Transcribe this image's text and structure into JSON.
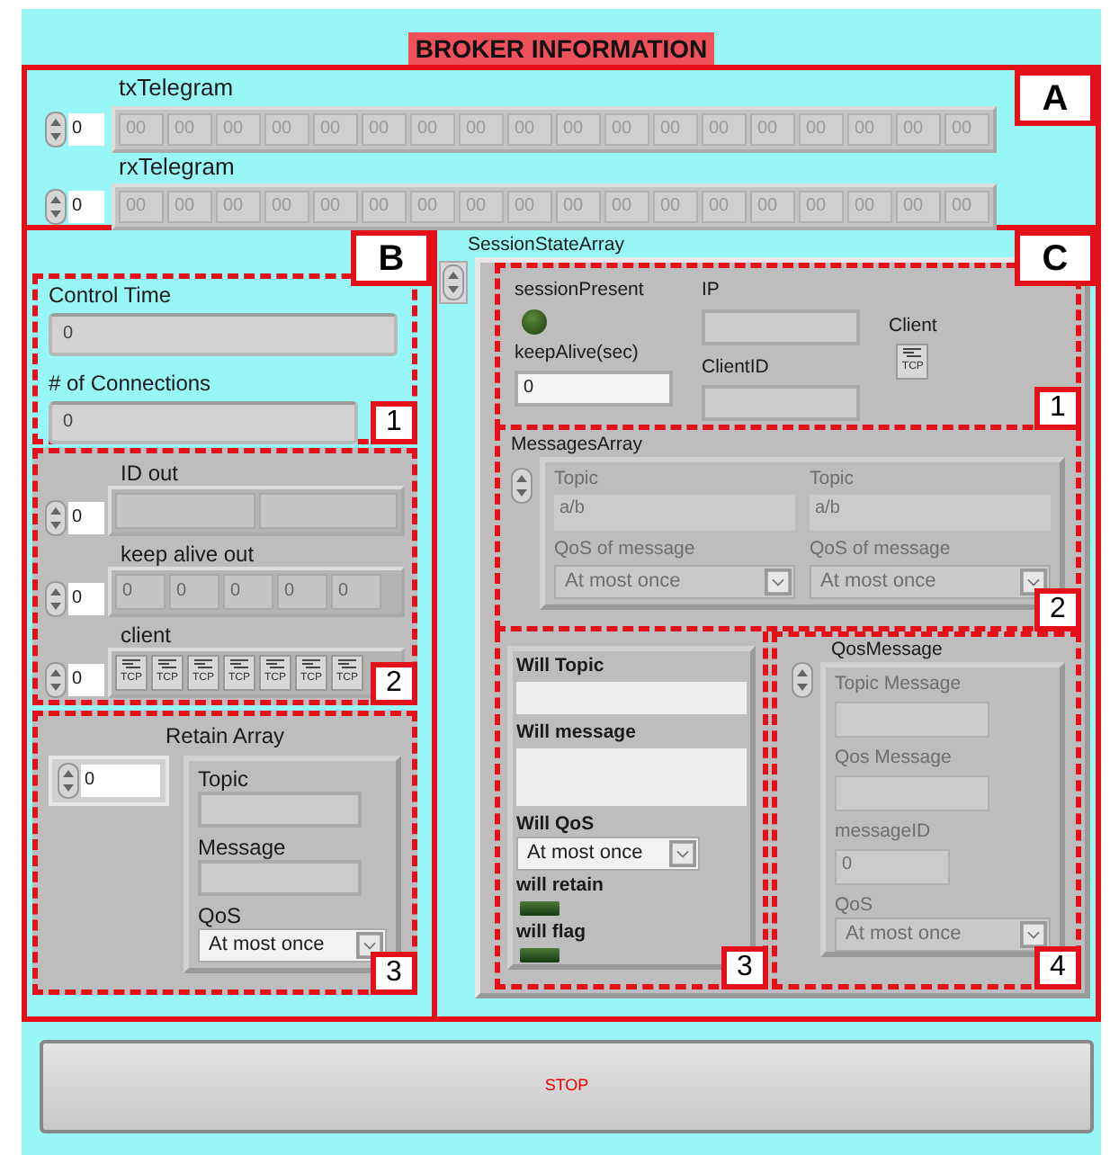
{
  "title": "BROKER INFORMATION",
  "section_a": {
    "marker": "A",
    "telegrams": [
      {
        "label": "txTelegram",
        "index": "0",
        "bytes": [
          "00",
          "00",
          "00",
          "00",
          "00",
          "00",
          "00",
          "00",
          "00",
          "00",
          "00",
          "00",
          "00",
          "00",
          "00",
          "00",
          "00",
          "00"
        ]
      },
      {
        "label": "rxTelegram",
        "index": "0",
        "bytes": [
          "00",
          "00",
          "00",
          "00",
          "00",
          "00",
          "00",
          "00",
          "00",
          "00",
          "00",
          "00",
          "00",
          "00",
          "00",
          "00",
          "00",
          "00"
        ]
      }
    ]
  },
  "section_b": {
    "marker": "B",
    "status": {
      "marker": "1",
      "fields": [
        {
          "label": "Control Time",
          "value": "0"
        },
        {
          "label": "# of Connections",
          "value": "0"
        }
      ]
    },
    "outputs": {
      "marker": "2",
      "arrays": [
        {
          "label": "ID out",
          "index": "0",
          "kind": "text",
          "cells": [
            {},
            {}
          ]
        },
        {
          "label": "keep alive out",
          "index": "0",
          "kind": "number",
          "cells": [
            {
              "value": "0"
            },
            {
              "value": "0"
            },
            {
              "value": "0"
            },
            {
              "value": "0"
            },
            {
              "value": "0"
            }
          ]
        },
        {
          "label": "client",
          "index": "0",
          "kind": "tcp",
          "cells": [
            {
              "value": "TCP"
            },
            {
              "value": "TCP"
            },
            {
              "value": "TCP"
            },
            {
              "value": "TCP"
            },
            {
              "value": "TCP"
            },
            {
              "value": "TCP"
            },
            {
              "value": "TCP"
            }
          ]
        }
      ]
    },
    "retain": {
      "marker": "3",
      "label": "Retain Array",
      "index": "0",
      "fields": [
        {
          "label": "Topic",
          "kind": "text"
        },
        {
          "label": "Message",
          "kind": "text"
        },
        {
          "label": "QoS",
          "kind": "select",
          "value": "At most once"
        }
      ]
    }
  },
  "section_c": {
    "marker": "C",
    "label": "SessionStateArray",
    "session": {
      "marker": "1",
      "session_present": {
        "label": "sessionPresent",
        "on": false
      },
      "keep_alive": {
        "label": "keepAlive(sec)",
        "value": "0"
      },
      "ip": {
        "label": "IP"
      },
      "client_id": {
        "label": "ClientID"
      },
      "client": {
        "label": "Client",
        "icon_text": "TCP"
      }
    },
    "messages": {
      "marker": "2",
      "label": "MessagesArray",
      "disabled": true,
      "items": [
        {
          "topic_label": "Topic",
          "topic": "a/b",
          "qos_label": "QoS of message",
          "qos": "At most once"
        },
        {
          "topic_label": "Topic",
          "topic": "a/b",
          "qos_label": "QoS of message",
          "qos": "At most once"
        }
      ]
    },
    "will": {
      "marker": "3",
      "fields": [
        {
          "label": "Will Topic",
          "kind": "text"
        },
        {
          "label": "Will message",
          "kind": "textarea"
        },
        {
          "label": "Will QoS",
          "kind": "select",
          "value": "At most once"
        },
        {
          "label": "will retain",
          "kind": "led",
          "on": false
        },
        {
          "label": "will flag",
          "kind": "led",
          "on": false
        }
      ]
    },
    "qos_message": {
      "marker": "4",
      "label": "QosMessage",
      "disabled": true,
      "fields": [
        {
          "label": "Topic Message",
          "kind": "text"
        },
        {
          "label": "Qos Message",
          "kind": "text"
        },
        {
          "label": "messageID",
          "kind": "text",
          "value": "0"
        },
        {
          "label": "QoS",
          "kind": "select",
          "value": "At most once"
        }
      ]
    }
  },
  "stop_button": "STOP"
}
